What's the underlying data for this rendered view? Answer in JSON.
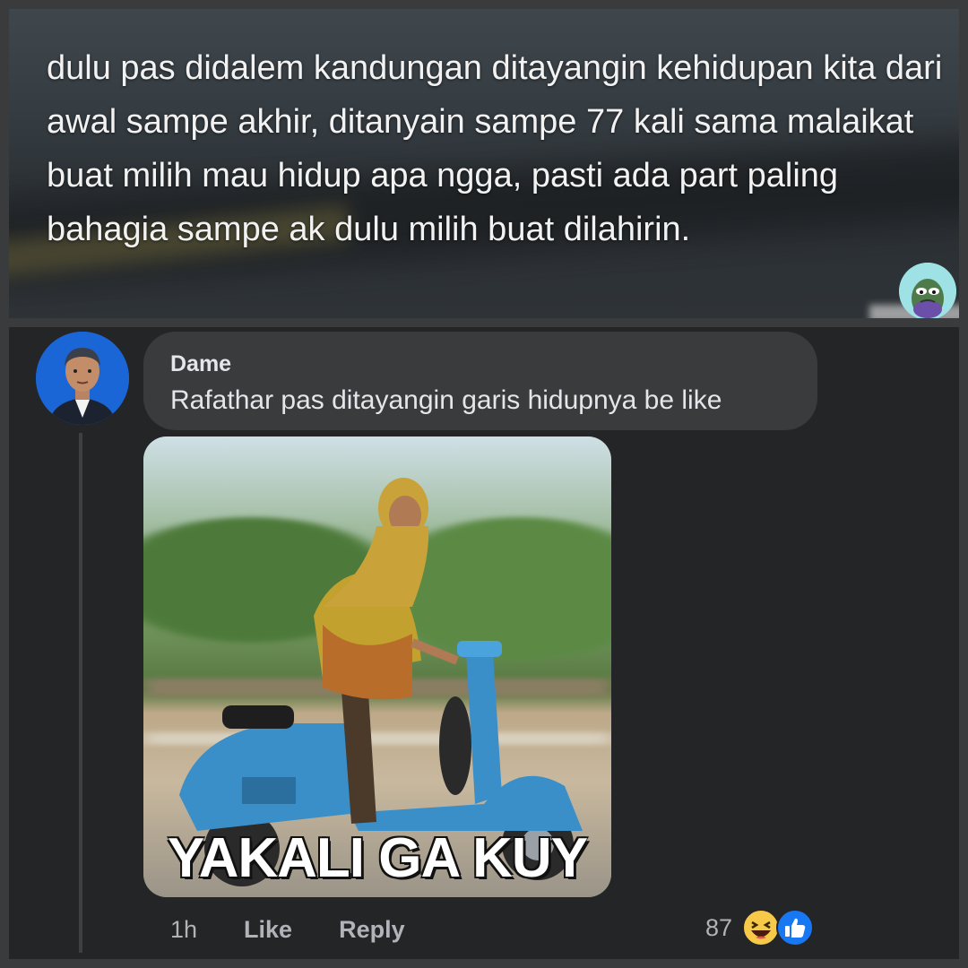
{
  "quoted_post": {
    "text": "dulu pas didalem kandungan ditayangin kehidupan kita dari awal sampe akhir, ditanyain sampe 77 kali sama malaikat buat milih mau hidup apa ngga, pasti ada part paling bahagia sampe ak dulu milih buat dilahirin."
  },
  "comment": {
    "author": "Dame",
    "text": "Rafathar pas ditayangin garis hidupnya be like",
    "meme_caption": "YAKALI GA KUY",
    "time": "1h",
    "like_label": "Like",
    "reply_label": "Reply",
    "reaction_count": "87",
    "reaction_icons": [
      "haha-icon",
      "like-icon"
    ]
  },
  "colors": {
    "background": "#3a3b3c",
    "comment_panel": "#242526",
    "bubble": "#3a3b3c",
    "text_primary": "#e4e6eb",
    "text_secondary": "#b0b3b8",
    "like_blue": "#1877f2",
    "haha_yellow": "#f7c948"
  }
}
